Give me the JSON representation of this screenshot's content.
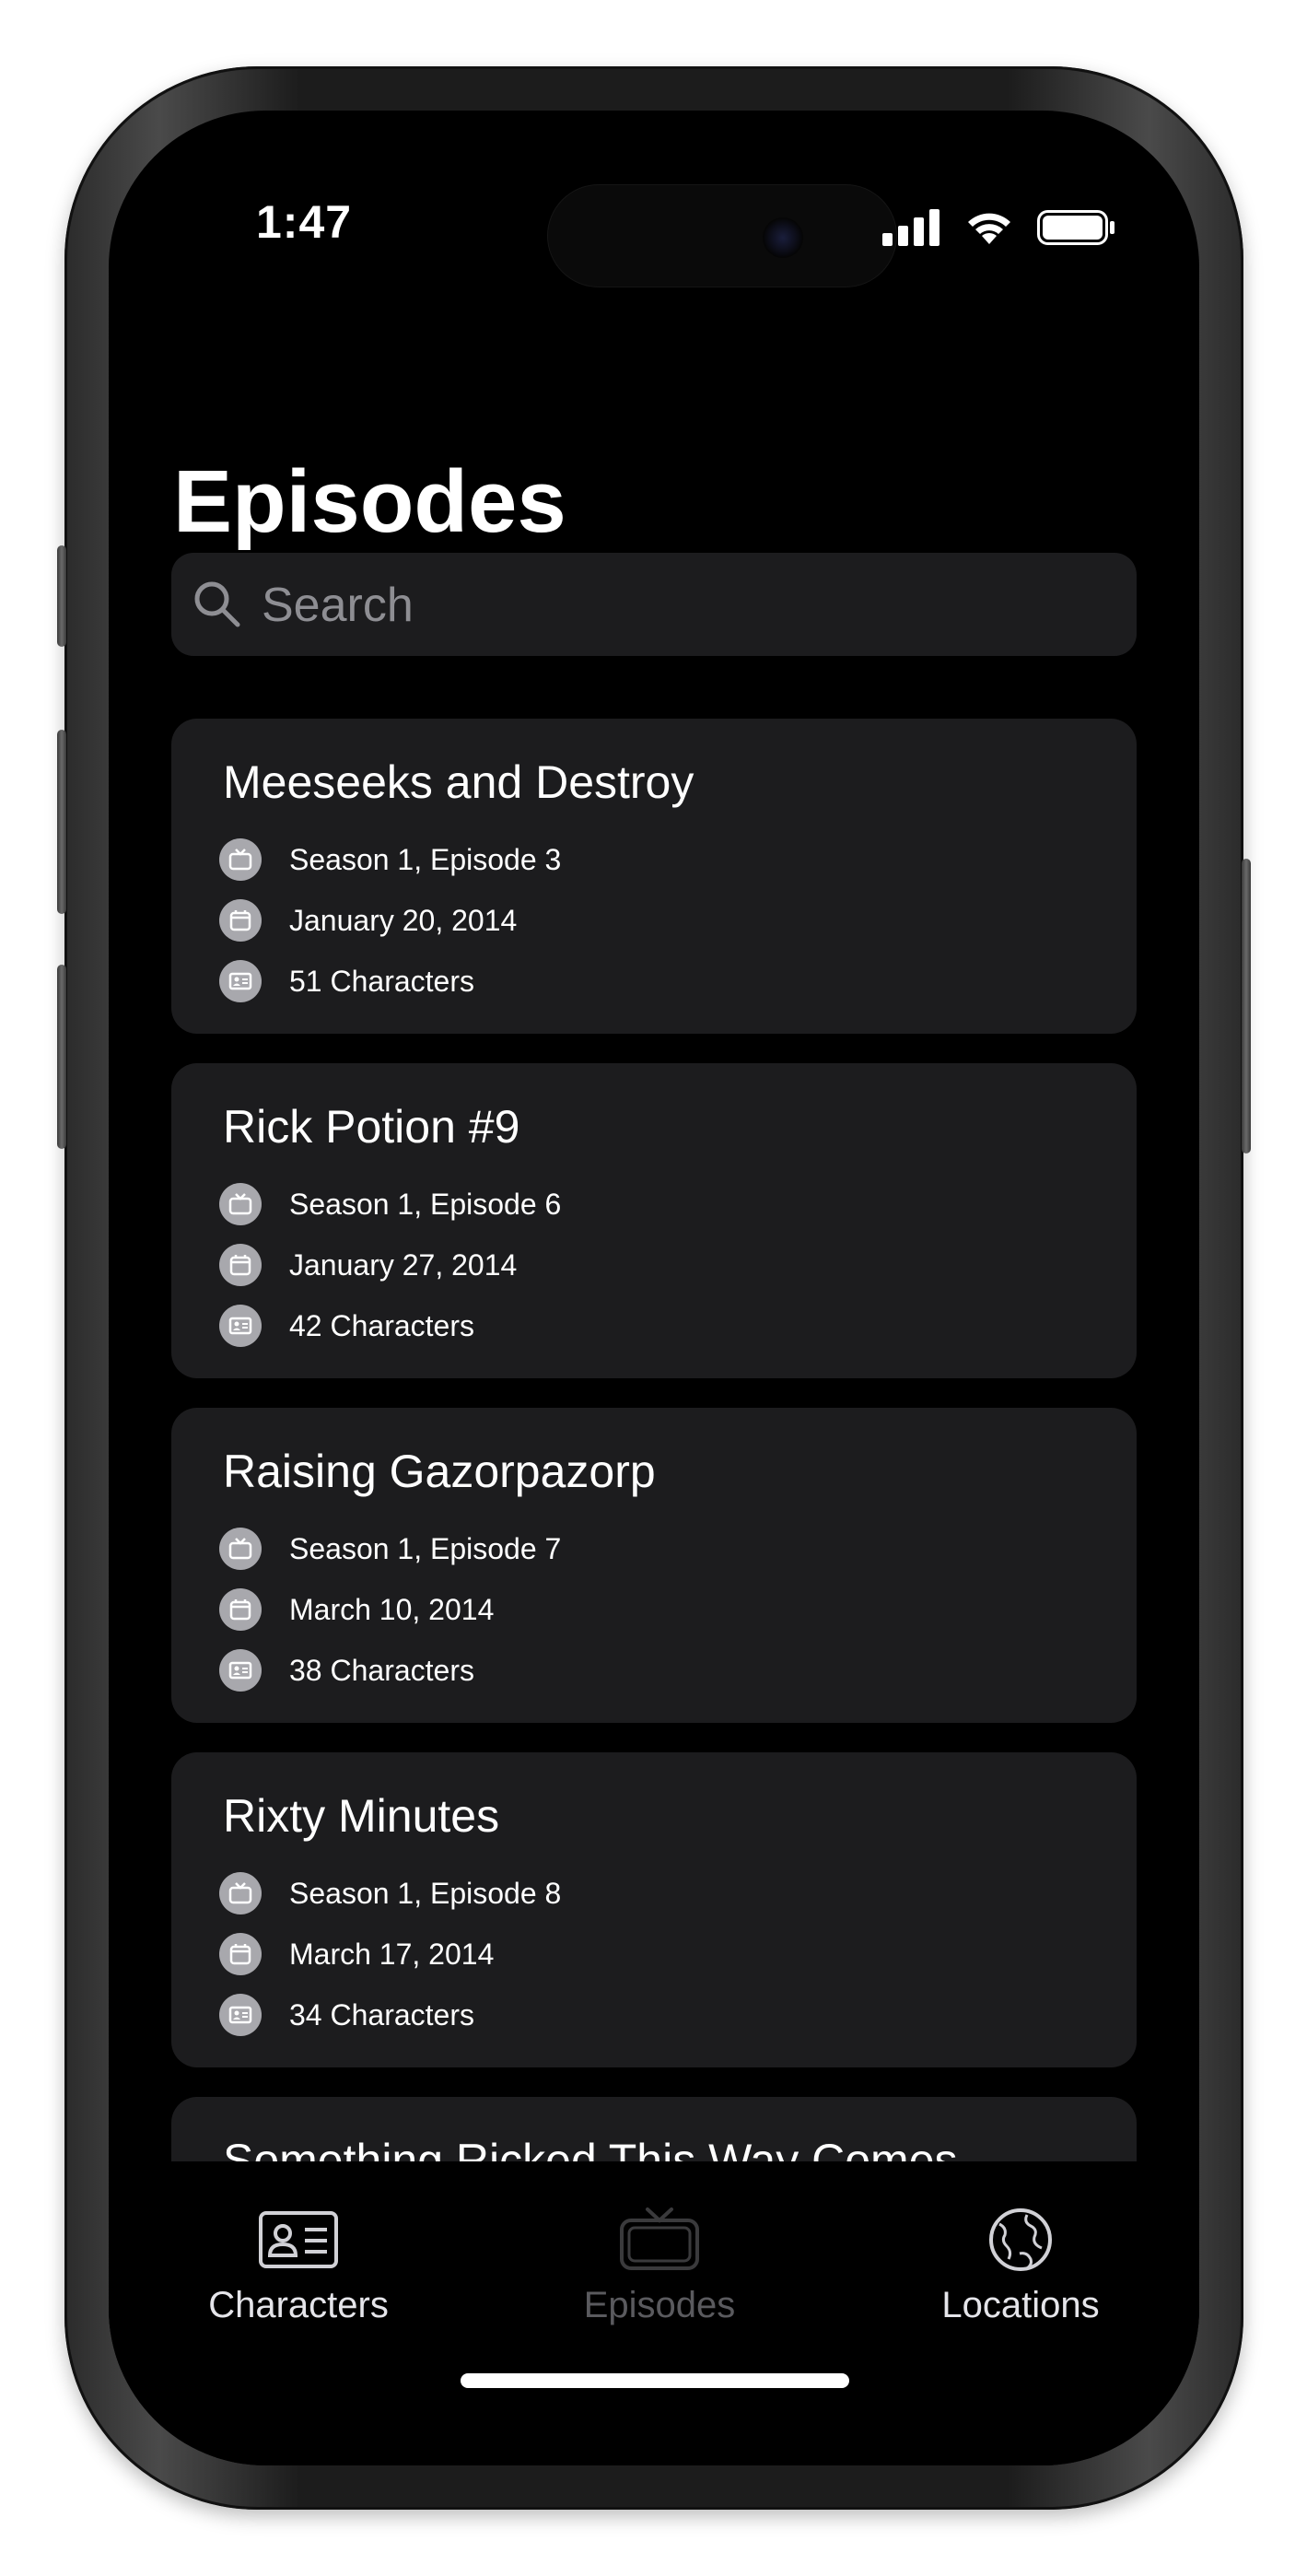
{
  "status_bar": {
    "time": "1:47"
  },
  "header": {
    "title": "Episodes"
  },
  "search": {
    "placeholder": "Search"
  },
  "episodes": [
    {
      "title": "Meeseeks and Destroy",
      "episode": "Season 1, Episode 3",
      "air_date": "January 20, 2014",
      "characters": "51 Characters"
    },
    {
      "title": "Rick Potion #9",
      "episode": "Season 1, Episode 6",
      "air_date": "January 27, 2014",
      "characters": "42 Characters"
    },
    {
      "title": "Raising Gazorpazorp",
      "episode": "Season 1, Episode 7",
      "air_date": "March 10, 2014",
      "characters": "38 Characters"
    },
    {
      "title": "Rixty Minutes",
      "episode": "Season 1, Episode 8",
      "air_date": "March 17, 2014",
      "characters": "34 Characters"
    },
    {
      "title": "Something Ricked This Way Comes"
    }
  ],
  "tabs": [
    {
      "label": "Characters",
      "icon": "person-card-icon",
      "active": true
    },
    {
      "label": "Episodes",
      "icon": "tv-icon",
      "active": false
    },
    {
      "label": "Locations",
      "icon": "globe-icon",
      "active": true
    }
  ]
}
